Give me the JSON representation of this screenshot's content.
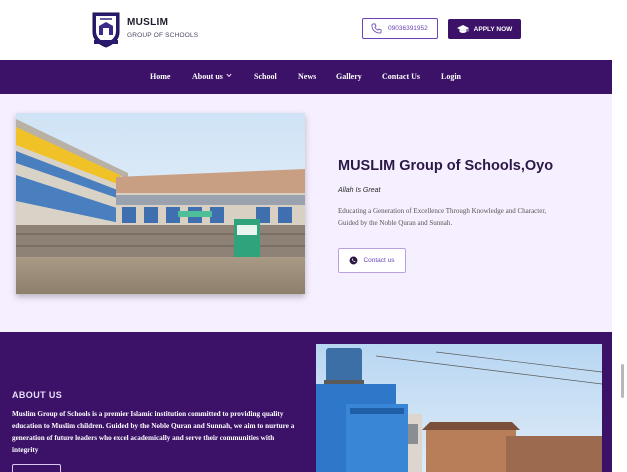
{
  "header": {
    "brand_name": "MUSLIM",
    "brand_sub": "GROUP OF SCHOOLS",
    "phone": "09036391952",
    "apply_label": "APPLY NOW"
  },
  "nav": {
    "items": [
      "Home",
      "About us",
      "School",
      "News",
      "Gallery",
      "Contact Us",
      "Login"
    ]
  },
  "hero": {
    "title": "MUSLIM Group of Schools,Oyo",
    "tagline": "Allah Is Great",
    "description": "Educating a Generation of Excellence Through Knowledge and Character, Guided by the Noble Quran and Sunnah.",
    "contact_label": "Contact us"
  },
  "about": {
    "heading": "ABOUT US",
    "text": "Muslim Group of Schools is a premier Islamic institution committed to providing quality education to Muslim children. Guided by the Noble Quran and Sunnah, we aim to nurture a generation of future leaders who excel academically and serve their communities with integrity"
  },
  "colors": {
    "brand_purple": "#3b1268",
    "accent_purple": "#6f3fb8",
    "hero_bg": "#f6efff"
  },
  "icons": {
    "phone": "phone-icon",
    "apply": "graduation-cap-icon",
    "contact": "whatsapp-icon",
    "dropdown": "chevron-down-icon"
  }
}
